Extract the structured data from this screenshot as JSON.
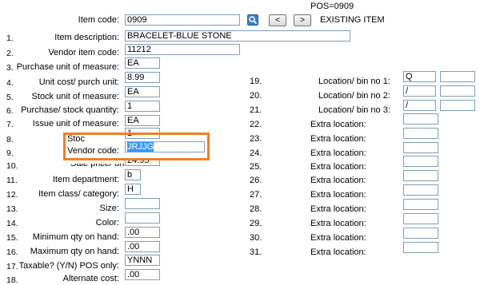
{
  "header": {
    "pos_label": "POS=0909",
    "item_code_label": "Item code:",
    "item_code_value": "0909",
    "prev_label": "<",
    "next_label": ">",
    "status": "EXISTING ITEM"
  },
  "fields": {
    "f1": {
      "num": "1.",
      "label": "Item description:",
      "value": "BRACELET-BLUE STONE"
    },
    "f2": {
      "num": "2.",
      "label": "Vendor item code:",
      "value": "11212"
    },
    "f3": {
      "num": "3.",
      "label": "Purchase unit of measure:",
      "value": "EA"
    },
    "f4": {
      "num": "4.",
      "label": "Unit cost/ purch unit:",
      "value": "8.99"
    },
    "f5": {
      "num": "5.",
      "label": "Stock unit of measure:",
      "value": "EA"
    },
    "f6": {
      "num": "6.",
      "label": "Purchase/ stock quantity:",
      "value": "1"
    },
    "f7": {
      "num": "7.",
      "label": "Issue unit of measure:",
      "value": "EA"
    },
    "f8": {
      "num": "8.",
      "label": "Stoc",
      "value": "1"
    },
    "f9": {
      "num": "9.",
      "label": "Vendor code:",
      "value": "JRJJG"
    },
    "f10": {
      "num": "10.",
      "label": "Sale price/ unit:",
      "value": "24.95"
    },
    "f11": {
      "num": "11.",
      "label": "Item department:",
      "value": "b"
    },
    "f12": {
      "num": "12.",
      "label": "Item class/ category:",
      "value": "H"
    },
    "f13": {
      "num": "13.",
      "label": "Size:",
      "value": ""
    },
    "f14": {
      "num": "14.",
      "label": "Color:",
      "value": ""
    },
    "f15": {
      "num": "15.",
      "label": "Minimum qty on hand:",
      "value": ".00"
    },
    "f16": {
      "num": "16.",
      "label": "Maximum qty on hand:",
      "value": ".00"
    },
    "f17": {
      "num": "17.",
      "label": "Taxable? (Y/N) POS only:",
      "value": "YNNN"
    },
    "f18": {
      "num": "18.",
      "label": "Alternate cost:",
      "value": ".00"
    }
  },
  "locations": {
    "f19": {
      "num": "19.",
      "label": "Location/ bin no 1:",
      "value": "Q",
      "value2": ""
    },
    "f20": {
      "num": "20.",
      "label": "Location/ bin no 2:",
      "value": "/",
      "value2": ""
    },
    "f21": {
      "num": "21.",
      "label": "Location/ bin no 3:",
      "value": "/",
      "value2": ""
    },
    "f22": {
      "num": "22.",
      "label": "Extra location:",
      "value": ""
    },
    "f23": {
      "num": "23.",
      "label": "Extra location:",
      "value": ""
    },
    "f24": {
      "num": "24.",
      "label": "Extra location:",
      "value": ""
    },
    "f25": {
      "num": "25.",
      "label": "Extra location:",
      "value": ""
    },
    "f26": {
      "num": "26.",
      "label": "Extra location:",
      "value": ""
    },
    "f27": {
      "num": "27.",
      "label": "Extra location:",
      "value": ""
    },
    "f28": {
      "num": "28.",
      "label": "Extra location:",
      "value": ""
    },
    "f29": {
      "num": "29.",
      "label": "Extra location:",
      "value": ""
    },
    "f30": {
      "num": "30.",
      "label": "Extra location:",
      "value": ""
    },
    "f31": {
      "num": "31.",
      "label": "Extra location:",
      "value": ""
    }
  },
  "colors": {
    "highlight": "#f37e21",
    "selection": "#3399ff",
    "search_button": "#3a7fd0"
  },
  "icons": {
    "search": "magnifier-icon"
  }
}
